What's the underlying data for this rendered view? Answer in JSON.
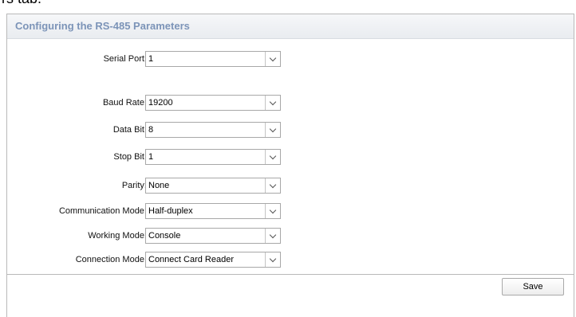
{
  "caption_fragment": "rs tab.",
  "panel": {
    "title": "Configuring the RS-485 Parameters"
  },
  "fields": {
    "serial_port": {
      "label": "Serial Port:",
      "value": "1"
    },
    "baud_rate": {
      "label": "Baud Rate:",
      "value": "19200"
    },
    "data_bit": {
      "label": "Data Bit:",
      "value": "8"
    },
    "stop_bit": {
      "label": "Stop Bit:",
      "value": "1"
    },
    "parity": {
      "label": "Parity:",
      "value": "None"
    },
    "communication_mode": {
      "label": "Communication Mode:",
      "value": "Half-duplex"
    },
    "working_mode": {
      "label": "Working Mode:",
      "value": "Console"
    },
    "connection_mode": {
      "label": "Connection Mode:",
      "value": "Connect Card Reader"
    }
  },
  "footer": {
    "save_label": "Save"
  }
}
